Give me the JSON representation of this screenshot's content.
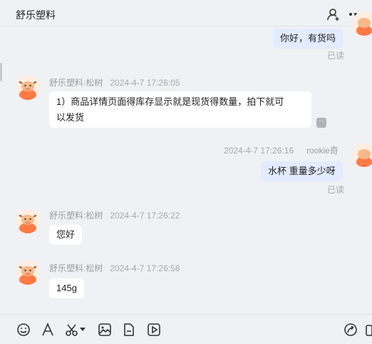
{
  "header": {
    "title": "舒乐塑料",
    "icons": [
      "add-contact-icon",
      "more-icon"
    ]
  },
  "messages": [
    {
      "id": "m1",
      "side": "right",
      "text": "你好，有货吗",
      "status": "已读"
    },
    {
      "id": "m2",
      "side": "left",
      "sender": "舒乐塑料:松树",
      "time": "2024-4-7 17:26:05",
      "text_line1": "1）商品详情页面得库存显示就是现货得数量，拍下就可",
      "text_line2": "以发货"
    },
    {
      "id": "m3",
      "side": "right",
      "sender": "rookie奇",
      "time": "2024-4-7 17:26:16",
      "text": "水杯 重量多少呀",
      "status": "已读"
    },
    {
      "id": "m4",
      "side": "left",
      "sender": "舒乐塑料:松树",
      "time": "2024-4-7 17:26:22",
      "text": "您好"
    },
    {
      "id": "m5",
      "side": "left",
      "sender": "舒乐塑料:松树",
      "time": "2024-4-7 17:26:58",
      "text": "145g"
    }
  ],
  "toolbar": {
    "icons": [
      "emoji-icon",
      "font-icon",
      "scissors-icon",
      "image-icon",
      "file-icon",
      "video-icon",
      "share-icon",
      "cloud-icon"
    ]
  },
  "colors": {
    "background": "#f0f1f5",
    "my_bubble": "#e3ebff",
    "their_bubble": "#ffffff",
    "accent": "#ff7a45"
  }
}
